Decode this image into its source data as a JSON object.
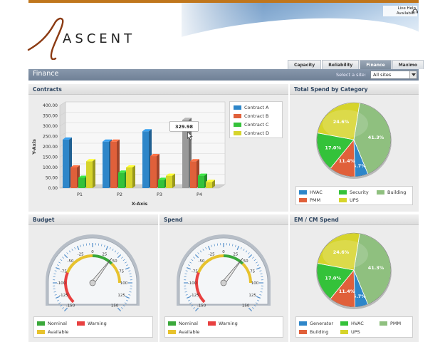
{
  "header": {
    "brand": "ASCENT",
    "live_help": "Live Help Available!"
  },
  "tabs": [
    {
      "label": "Capacity",
      "active": false
    },
    {
      "label": "Reliability",
      "active": false
    },
    {
      "label": "Finance",
      "active": true
    },
    {
      "label": "Maximo",
      "active": false
    }
  ],
  "titlebar": {
    "title": "Finance",
    "site_label": "Select a site:",
    "site_value": "All sites"
  },
  "contracts": {
    "title": "Contracts",
    "legend": [
      {
        "label": "Contract A",
        "color": "#2e86c9"
      },
      {
        "label": "Contract B",
        "color": "#e0603a"
      },
      {
        "label": "Contract C",
        "color": "#34c23a"
      },
      {
        "label": "Contract D",
        "color": "#d6d42b"
      }
    ],
    "tooltip": "329.98"
  },
  "chart_data": [
    {
      "type": "bar",
      "categories": [
        "P1",
        "P2",
        "P3",
        "P4"
      ],
      "series": [
        {
          "name": "Contract A",
          "values": [
            235,
            225,
            275,
            330
          ]
        },
        {
          "name": "Contract B",
          "values": [
            100,
            225,
            155,
            130
          ]
        },
        {
          "name": "Contract C",
          "values": [
            50,
            75,
            40,
            60
          ]
        },
        {
          "name": "Contract D",
          "values": [
            130,
            100,
            60,
            30
          ]
        }
      ],
      "xlabel": "X-Axis",
      "ylabel": "Y-Axis",
      "ylim": [
        0,
        400
      ],
      "yticks": [
        "0.00",
        "50.00",
        "100.00",
        "150.00",
        "200.00",
        "250.00",
        "300.00",
        "350.00",
        "400.00"
      ],
      "grid": true,
      "legend": "right"
    },
    {
      "type": "pie",
      "title": "Total Spend by Category",
      "labels": [
        "Building",
        "HVAC",
        "PMM",
        "Security",
        "UPS"
      ],
      "values": [
        41.3,
        5.7,
        11.4,
        17.0,
        24.6
      ],
      "value_labels": [
        "41.3%",
        "5.7%",
        "11.4%",
        "17.0%",
        "24.6%"
      ],
      "colors": [
        "#8fc07f",
        "#2e86c9",
        "#e0603a",
        "#34c23a",
        "#d6d42b"
      ],
      "legend": "bottom"
    },
    {
      "type": "pie",
      "title": "EM / CM Spend",
      "labels": [
        "PMM",
        "Generator",
        "Building",
        "HVAC",
        "UPS"
      ],
      "values": [
        41.3,
        5.7,
        11.4,
        17.0,
        24.6
      ],
      "value_labels": [
        "41.3%",
        "5.7%",
        "11.4%",
        "17.0%",
        "24.6%"
      ],
      "colors": [
        "#8fc07f",
        "#2e86c9",
        "#e0603a",
        "#34c23a",
        "#d6d42b"
      ],
      "legend": "bottom"
    }
  ],
  "total_spend": {
    "title": "Total Spend by Category",
    "legend": [
      {
        "label": "HVAC",
        "color": "#2e86c9"
      },
      {
        "label": "Security",
        "color": "#34c23a"
      },
      {
        "label": "Building",
        "color": "#8fc07f"
      },
      {
        "label": "PMM",
        "color": "#e0603a"
      },
      {
        "label": "UPS",
        "color": "#d6d42b"
      }
    ]
  },
  "budget": {
    "title": "Budget",
    "needle": 42,
    "legend": [
      {
        "label": "Nominal",
        "color": "#3aa83a"
      },
      {
        "label": "Warning",
        "color": "#e84040"
      },
      {
        "label": "Available",
        "color": "#e7c22e"
      }
    ]
  },
  "spend": {
    "title": "Spend",
    "needle": 42,
    "legend": [
      {
        "label": "Nominal",
        "color": "#3aa83a"
      },
      {
        "label": "Warning",
        "color": "#e84040"
      },
      {
        "label": "Available",
        "color": "#e7c22e"
      }
    ]
  },
  "gauge": {
    "ticks": [
      "-150",
      "-125",
      "-100",
      "-75",
      "-50",
      "-25",
      "0",
      "25",
      "50",
      "75",
      "100",
      "125",
      "150"
    ],
    "min": -150,
    "max": 150
  },
  "emcm": {
    "title": "EM / CM Spend",
    "legend": [
      {
        "label": "Generator",
        "color": "#2e86c9"
      },
      {
        "label": "HVAC",
        "color": "#34c23a"
      },
      {
        "label": "PMM",
        "color": "#8fc07f"
      },
      {
        "label": "Building",
        "color": "#e0603a"
      },
      {
        "label": "UPS",
        "color": "#d6d42b"
      }
    ]
  }
}
